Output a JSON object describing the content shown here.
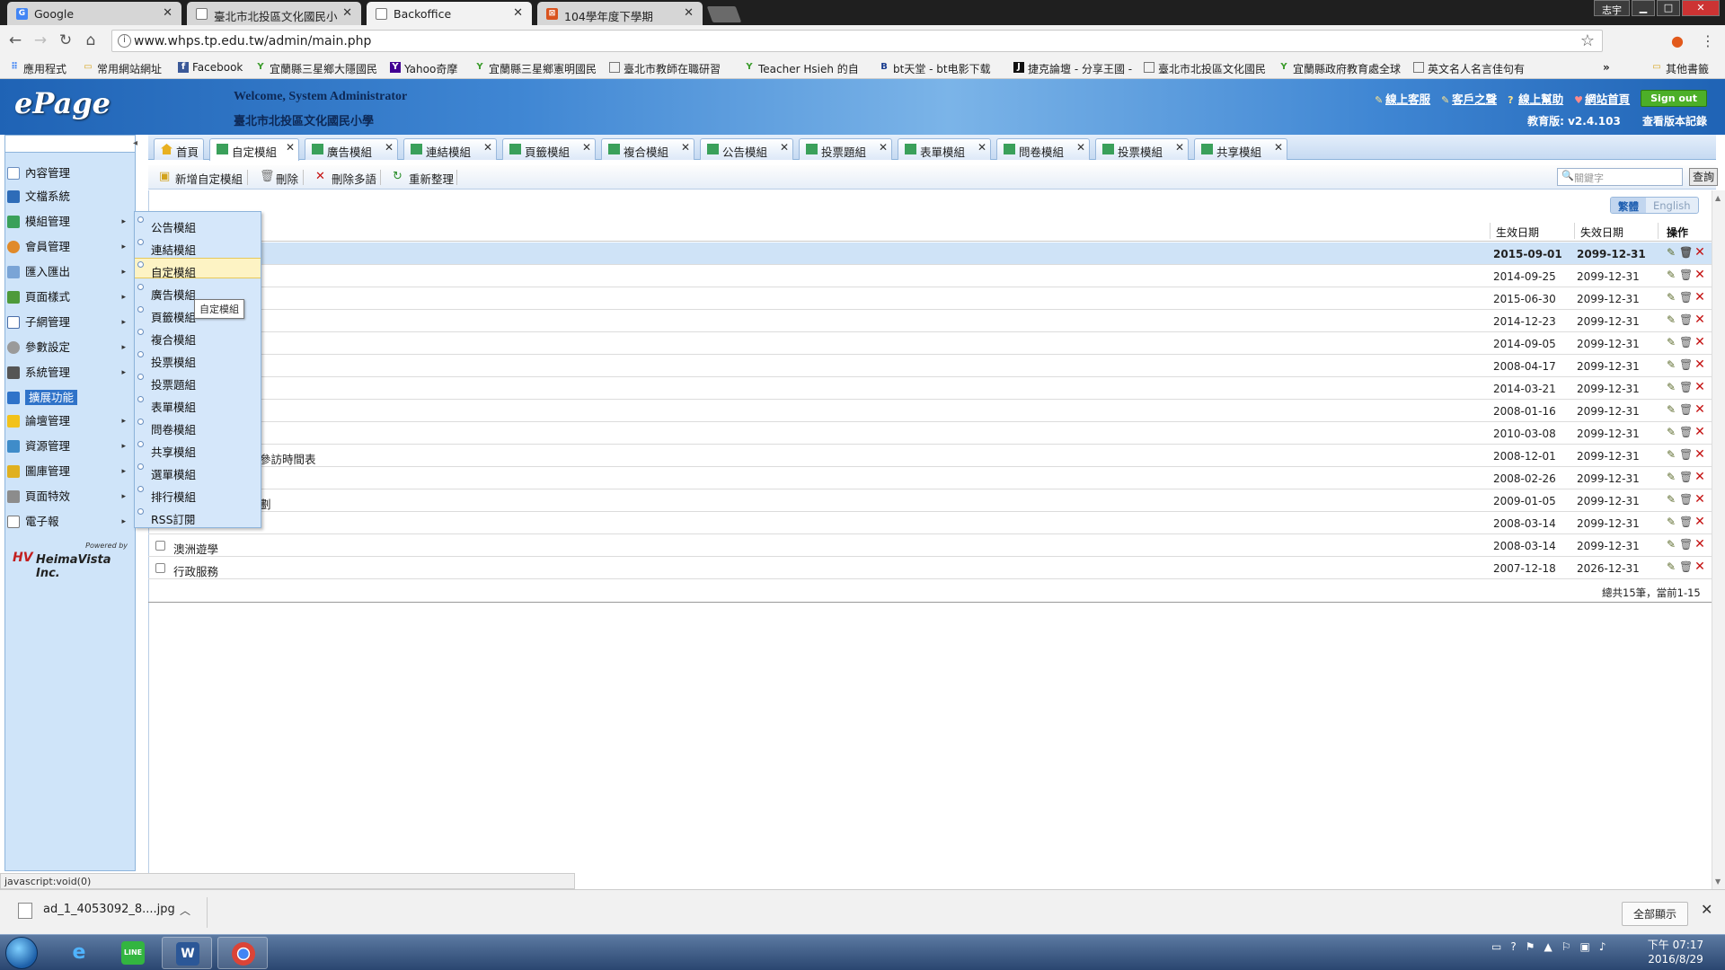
{
  "browser": {
    "tabs": [
      {
        "title": "Google",
        "favicon": "google-icon",
        "color": "#4285f4"
      },
      {
        "title": "臺北市北投區文化國民小",
        "favicon": "page-icon",
        "color": "#777777"
      },
      {
        "title": "Backoffice",
        "favicon": "page-icon",
        "color": "#777777"
      },
      {
        "title": "104學年度下學期",
        "favicon": "calendar-icon",
        "color": "#d9531e"
      }
    ],
    "window_user": "志宇",
    "url": "www.whps.tp.edu.tw/admin/main.php",
    "bookmarks": [
      {
        "label": "應用程式",
        "icon": "apps-icon"
      },
      {
        "label": "常用網站網址",
        "icon": "folder-icon"
      },
      {
        "label": "Facebook",
        "icon": "facebook-icon"
      },
      {
        "label": "宜蘭縣三星鄉大隱國民",
        "icon": "y-icon"
      },
      {
        "label": "Yahoo奇摩",
        "icon": "yahoo-icon"
      },
      {
        "label": "宜蘭縣三星鄉憲明國民",
        "icon": "y-icon"
      },
      {
        "label": "臺北市教師在職研習",
        "icon": "page-icon"
      },
      {
        "label": "Teacher Hsieh 的自",
        "icon": "y-icon"
      },
      {
        "label": "bt天堂 - bt电影下载",
        "icon": "bt-icon"
      },
      {
        "label": "捷克論壇 - 分享王國 -",
        "icon": "jk-icon"
      },
      {
        "label": "臺北市北投區文化國民",
        "icon": "page-icon"
      },
      {
        "label": "宜蘭縣政府教育處全球",
        "icon": "y-icon"
      },
      {
        "label": "英文名人名言佳句有",
        "icon": "page-icon"
      },
      {
        "label": "其他書籤",
        "icon": "folder-icon"
      }
    ]
  },
  "header": {
    "logo": "ePage",
    "welcome": "Welcome, System Administrator",
    "school": "臺北市北投區文化國民小學",
    "links": [
      "線上客服",
      "客戶之聲",
      "線上幫助",
      "網站首頁"
    ],
    "signout": "Sign out",
    "version": "教育版: v2.4.103",
    "version_log": "查看版本記錄"
  },
  "sidebar": {
    "items": [
      {
        "label": "內容管理",
        "arrow": ""
      },
      {
        "label": "文檔系統",
        "arrow": ""
      },
      {
        "label": "模組管理",
        "arrow": "▸"
      },
      {
        "label": "會員管理",
        "arrow": "▸"
      },
      {
        "label": "匯入匯出",
        "arrow": "▸"
      },
      {
        "label": "頁面樣式",
        "arrow": "▸"
      },
      {
        "label": "子網管理",
        "arrow": "▸"
      },
      {
        "label": "參數設定",
        "arrow": "▸"
      },
      {
        "label": "系統管理",
        "arrow": "▸"
      },
      {
        "label": "擴展功能",
        "arrow": ""
      },
      {
        "label": "論壇管理",
        "arrow": "▸"
      },
      {
        "label": "資源管理",
        "arrow": "▸"
      },
      {
        "label": "圖庫管理",
        "arrow": "▸"
      },
      {
        "label": "頁面特效",
        "arrow": "▸"
      },
      {
        "label": "電子報",
        "arrow": "▸"
      }
    ],
    "powered_by": "Powered by",
    "vendor": "HeimaVista Inc."
  },
  "module_tabs": [
    "首頁",
    "自定模組",
    "廣告模組",
    "連結模組",
    "頁籤模組",
    "複合模組",
    "公告模組",
    "投票題組",
    "表單模組",
    "問卷模組",
    "投票模組",
    "共享模組"
  ],
  "toolbar": {
    "add": "新增自定模組",
    "delete": "刪除",
    "delete_multi": "刪除多語",
    "reorganize": "重新整理",
    "search_placeholder": "關鍵字",
    "search_button": "查詢"
  },
  "lang": {
    "zh": "繁體",
    "en": "English"
  },
  "table": {
    "headers": {
      "start": "生效日期",
      "end": "失效日期",
      "ops": "操作"
    },
    "rows": [
      {
        "name": "",
        "start": "2015-09-01",
        "end": "2099-12-31"
      },
      {
        "name": "",
        "start": "2014-09-25",
        "end": "2099-12-31"
      },
      {
        "name": "",
        "start": "2015-06-30",
        "end": "2099-12-31"
      },
      {
        "name": "",
        "start": "2014-12-23",
        "end": "2099-12-31"
      },
      {
        "name": "",
        "start": "2014-09-05",
        "end": "2099-12-31"
      },
      {
        "name": "",
        "start": "2008-04-17",
        "end": "2099-12-31"
      },
      {
        "name": "",
        "start": "2014-03-21",
        "end": "2099-12-31"
      },
      {
        "name": "",
        "start": "2008-01-16",
        "end": "2099-12-31"
      },
      {
        "name": "",
        "start": "2010-03-08",
        "end": "2099-12-31"
      },
      {
        "name": "參訪時間表",
        "start": "2008-12-01",
        "end": "2099-12-31"
      },
      {
        "name": "",
        "start": "2008-02-26",
        "end": "2099-12-31"
      },
      {
        "name": "劃",
        "start": "2009-01-05",
        "end": "2099-12-31"
      },
      {
        "name": "",
        "start": "2008-03-14",
        "end": "2099-12-31"
      },
      {
        "name": "澳洲遊學",
        "start": "2008-03-14",
        "end": "2099-12-31"
      },
      {
        "name": "行政服務",
        "start": "2007-12-18",
        "end": "2026-12-31"
      }
    ],
    "summary": "總共15筆，當前1-15"
  },
  "flyout": {
    "items": [
      "公告模組",
      "連結模組",
      "自定模組",
      "廣告模組",
      "頁籤模組",
      "複合模組",
      "投票模組",
      "投票題組",
      "表單模組",
      "問卷模組",
      "共享模組",
      "選單模組",
      "排行模組",
      "RSS訂閱"
    ],
    "tooltip": "自定模組"
  },
  "status": "javascript:void(0)",
  "download": {
    "file": "ad_1_4053092_8....jpg",
    "show_all": "全部顯示"
  },
  "taskbar": {
    "time": "下午 07:17",
    "date": "2016/8/29"
  }
}
